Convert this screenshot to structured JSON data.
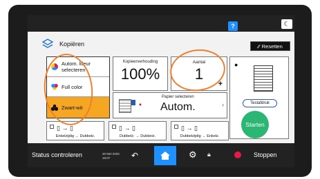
{
  "header": {
    "help_label": "?",
    "theme_icon": "moon-icon"
  },
  "app": {
    "title": "Kopiëren",
    "reset_label": "Resetten"
  },
  "color_options": [
    {
      "label": "Autom. kleur selecteren",
      "icon": "auto-color-icon"
    },
    {
      "label": "Full color",
      "icon": "full-color-icon"
    },
    {
      "label": "Zwart-wit",
      "icon": "black-white-icon",
      "selected": true
    }
  ],
  "ratio": {
    "label": "Kopieerverhouding",
    "value": "100%"
  },
  "quantity": {
    "label": "Aantal",
    "value": "1",
    "minus": "−",
    "plus": "+"
  },
  "paper": {
    "label": "Papier selecteren",
    "value": "Autom.",
    "chevron": "›"
  },
  "duplex": [
    {
      "label": "Enkelzijdig → Dubbelz."
    },
    {
      "label": "Dubbelz. → Dubbelz."
    },
    {
      "label": "Dubbelzijdig → Enkelz."
    }
  ],
  "preview": {
    "proof_label": "Testafdruk",
    "start_label": "Starten"
  },
  "footer": {
    "status_label": "Status controleren",
    "date": "20 Mei 2020",
    "time": "15:07",
    "stop_label": "Stoppen"
  },
  "colors": {
    "accent": "#1e90ff",
    "selected": "#f5a623",
    "start": "#2bb673",
    "annotation": "#ee7f2d"
  }
}
